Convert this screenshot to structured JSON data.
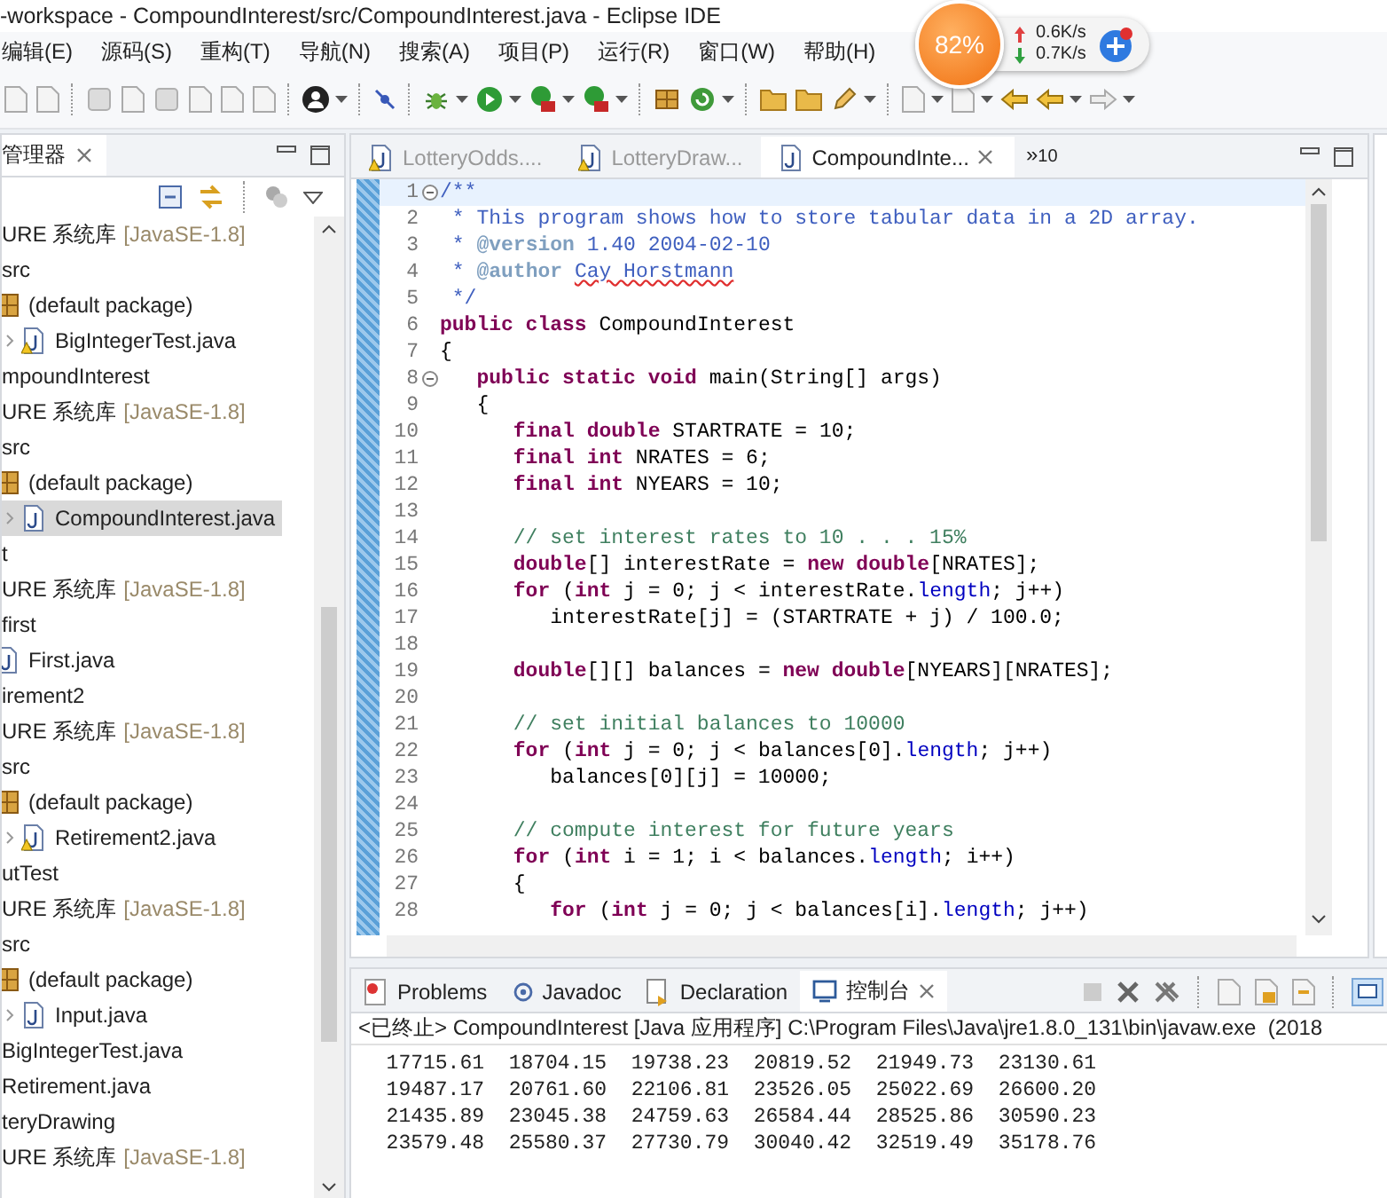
{
  "window": {
    "title": "-workspace - CompoundInterest/src/CompoundInterest.java - Eclipse IDE"
  },
  "menu": [
    "编辑(E)",
    "源码(S)",
    "重构(T)",
    "导航(N)",
    "搜索(A)",
    "项目(P)",
    "运行(R)",
    "窗口(W)",
    "帮助(H)"
  ],
  "network_widget": {
    "percent": "82%",
    "upload": "0.6K/s",
    "download": "0.7K/s"
  },
  "explorer": {
    "title": "管理器",
    "tree": [
      {
        "kind": "library",
        "label": "URE 系统库",
        "version": "[JavaSE-1.8]",
        "selected": false
      },
      {
        "kind": "folder",
        "label": "src",
        "selected": false,
        "children": [
          {
            "kind": "package",
            "label": "(default package)",
            "selected": false,
            "children": [
              {
                "kind": "java",
                "label": "BigIntegerTest.java",
                "warning": true,
                "selected": false
              }
            ]
          }
        ]
      },
      {
        "kind": "project",
        "label": "mpoundInterest",
        "selected": false,
        "children": [
          {
            "kind": "library",
            "label": "URE 系统库",
            "version": "[JavaSE-1.8]",
            "selected": false
          },
          {
            "kind": "folder",
            "label": "src",
            "selected": false,
            "children": [
              {
                "kind": "package",
                "label": "(default package)",
                "selected": false,
                "children": [
                  {
                    "kind": "java",
                    "label": "CompoundInterest.java",
                    "warning": false,
                    "selected": true
                  }
                ]
              }
            ]
          }
        ]
      },
      {
        "kind": "project",
        "label": "t",
        "selected": false,
        "children": [
          {
            "kind": "library",
            "label": "URE 系统库",
            "version": "[JavaSE-1.8]",
            "selected": false
          },
          {
            "kind": "folder",
            "label": "first",
            "selected": false,
            "children": [
              {
                "kind": "java",
                "label": "First.java",
                "warning": false,
                "selected": false
              }
            ]
          }
        ]
      },
      {
        "kind": "project",
        "label": "irement2",
        "selected": false,
        "children": [
          {
            "kind": "library",
            "label": "URE 系统库",
            "version": "[JavaSE-1.8]",
            "selected": false
          },
          {
            "kind": "folder",
            "label": "src",
            "selected": false,
            "children": [
              {
                "kind": "package",
                "label": "(default package)",
                "selected": false,
                "children": [
                  {
                    "kind": "java",
                    "label": "Retirement2.java",
                    "warning": true,
                    "selected": false
                  }
                ]
              }
            ]
          }
        ]
      },
      {
        "kind": "project",
        "label": "utTest",
        "selected": false,
        "children": [
          {
            "kind": "library",
            "label": "URE 系统库",
            "version": "[JavaSE-1.8]",
            "selected": false
          },
          {
            "kind": "folder",
            "label": "src",
            "selected": false,
            "children": [
              {
                "kind": "package",
                "label": "(default package)",
                "selected": false,
                "children": [
                  {
                    "kind": "java",
                    "label": "Input.java",
                    "warning": false,
                    "selected": false
                  }
                ]
              }
            ]
          }
        ]
      },
      {
        "kind": "java",
        "label": "BigIntegerTest.java",
        "selected": false
      },
      {
        "kind": "java",
        "label": "Retirement.java",
        "selected": false
      },
      {
        "kind": "project",
        "label": "teryDrawing",
        "selected": false,
        "children": [
          {
            "kind": "library",
            "label": "URE 系统库",
            "version": "[JavaSE-1.8]",
            "selected": false
          }
        ]
      }
    ]
  },
  "editor": {
    "tabs": [
      {
        "label": "LotteryOdds....",
        "warning": true,
        "selected": false
      },
      {
        "label": "LotteryDraw...",
        "warning": true,
        "selected": false
      },
      {
        "label": "CompoundInte...",
        "warning": false,
        "selected": true
      }
    ],
    "overflow": {
      "arrows": "»",
      "count": "10"
    },
    "lines": [
      {
        "number": "1",
        "foldable": true,
        "current": true,
        "tokens": [
          {
            "kind": "javadoc",
            "text": "/**"
          }
        ]
      },
      {
        "number": "2",
        "foldable": false,
        "current": false,
        "tokens": [
          {
            "kind": "javadoc",
            "text": " * This program shows how to store tabular data in a 2D array."
          }
        ]
      },
      {
        "number": "3",
        "foldable": false,
        "current": false,
        "tokens": [
          {
            "kind": "javadoc",
            "text": " * "
          },
          {
            "kind": "doctag",
            "text": "@version"
          },
          {
            "kind": "javadoc",
            "text": " 1.40 2004-02-10"
          }
        ]
      },
      {
        "number": "4",
        "foldable": false,
        "current": false,
        "tokens": [
          {
            "kind": "javadoc",
            "text": " * "
          },
          {
            "kind": "doctag",
            "text": "@author "
          },
          {
            "kind": "misspelled",
            "text": "Cay Horstmann"
          }
        ]
      },
      {
        "number": "5",
        "foldable": false,
        "current": false,
        "tokens": [
          {
            "kind": "javadoc",
            "text": " */"
          }
        ]
      },
      {
        "number": "6",
        "foldable": false,
        "current": false,
        "tokens": [
          {
            "kind": "keyword",
            "text": "public class"
          },
          {
            "kind": "plain",
            "text": " CompoundInterest"
          }
        ]
      },
      {
        "number": "7",
        "foldable": false,
        "current": false,
        "tokens": [
          {
            "kind": "plain",
            "text": "{"
          }
        ]
      },
      {
        "number": "8",
        "foldable": true,
        "current": false,
        "tokens": [
          {
            "kind": "keyword",
            "text": "   public static void"
          },
          {
            "kind": "plain",
            "text": " main(String[] args)"
          }
        ]
      },
      {
        "number": "9",
        "foldable": false,
        "current": false,
        "tokens": [
          {
            "kind": "plain",
            "text": "   {"
          }
        ]
      },
      {
        "number": "10",
        "foldable": false,
        "current": false,
        "tokens": [
          {
            "kind": "keyword",
            "text": "      final double"
          },
          {
            "kind": "plain",
            "text": " STARTRATE = 10;"
          }
        ]
      },
      {
        "number": "11",
        "foldable": false,
        "current": false,
        "tokens": [
          {
            "kind": "keyword",
            "text": "      final int"
          },
          {
            "kind": "plain",
            "text": " NRATES = 6;"
          }
        ]
      },
      {
        "number": "12",
        "foldable": false,
        "current": false,
        "tokens": [
          {
            "kind": "keyword",
            "text": "      final int"
          },
          {
            "kind": "plain",
            "text": " NYEARS = 10;"
          }
        ]
      },
      {
        "number": "13",
        "foldable": false,
        "current": false
      },
      {
        "number": "14",
        "foldable": false,
        "current": false,
        "tokens": [
          {
            "kind": "comment",
            "text": "      // set interest rates to 10 . . . 15%"
          }
        ]
      },
      {
        "number": "15",
        "foldable": false,
        "current": false,
        "tokens": [
          {
            "kind": "keyword",
            "text": "      double"
          },
          {
            "kind": "plain",
            "text": "[] interestRate = "
          },
          {
            "kind": "keyword",
            "text": "new double"
          },
          {
            "kind": "plain",
            "text": "[NRATES];"
          }
        ]
      },
      {
        "number": "16",
        "foldable": false,
        "current": false,
        "tokens": [
          {
            "kind": "keyword",
            "text": "      for"
          },
          {
            "kind": "plain",
            "text": " ("
          },
          {
            "kind": "keyword",
            "text": "int"
          },
          {
            "kind": "plain",
            "text": " j = 0; j < interestRate."
          },
          {
            "kind": "field",
            "text": "length"
          },
          {
            "kind": "plain",
            "text": "; j++)"
          }
        ]
      },
      {
        "number": "17",
        "foldable": false,
        "current": false,
        "tokens": [
          {
            "kind": "plain",
            "text": "         interestRate[j] = (STARTRATE + j) / 100.0;"
          }
        ]
      },
      {
        "number": "18",
        "foldable": false,
        "current": false
      },
      {
        "number": "19",
        "foldable": false,
        "current": false,
        "tokens": [
          {
            "kind": "keyword",
            "text": "      double"
          },
          {
            "kind": "plain",
            "text": "[][] balances = "
          },
          {
            "kind": "keyword",
            "text": "new double"
          },
          {
            "kind": "plain",
            "text": "[NYEARS][NRATES];"
          }
        ]
      },
      {
        "number": "20",
        "foldable": false,
        "current": false
      },
      {
        "number": "21",
        "foldable": false,
        "current": false,
        "tokens": [
          {
            "kind": "comment",
            "text": "      // set initial balances to 10000"
          }
        ]
      },
      {
        "number": "22",
        "foldable": false,
        "current": false,
        "tokens": [
          {
            "kind": "keyword",
            "text": "      for"
          },
          {
            "kind": "plain",
            "text": " ("
          },
          {
            "kind": "keyword",
            "text": "int"
          },
          {
            "kind": "plain",
            "text": " j = 0; j < balances[0]."
          },
          {
            "kind": "field",
            "text": "length"
          },
          {
            "kind": "plain",
            "text": "; j++)"
          }
        ]
      },
      {
        "number": "23",
        "foldable": false,
        "current": false,
        "tokens": [
          {
            "kind": "plain",
            "text": "         balances[0][j] = 10000;"
          }
        ]
      },
      {
        "number": "24",
        "foldable": false,
        "current": false
      },
      {
        "number": "25",
        "foldable": false,
        "current": false,
        "tokens": [
          {
            "kind": "comment",
            "text": "      // compute interest for future years"
          }
        ]
      },
      {
        "number": "26",
        "foldable": false,
        "current": false,
        "tokens": [
          {
            "kind": "keyword",
            "text": "      for"
          },
          {
            "kind": "plain",
            "text": " ("
          },
          {
            "kind": "keyword",
            "text": "int"
          },
          {
            "kind": "plain",
            "text": " i = 1; i < balances."
          },
          {
            "kind": "field",
            "text": "length"
          },
          {
            "kind": "plain",
            "text": "; i++)"
          }
        ]
      },
      {
        "number": "27",
        "foldable": false,
        "current": false,
        "tokens": [
          {
            "kind": "plain",
            "text": "      {"
          }
        ]
      },
      {
        "number": "28",
        "foldable": false,
        "current": false,
        "tokens": [
          {
            "kind": "keyword",
            "text": "         for"
          },
          {
            "kind": "plain",
            "text": " ("
          },
          {
            "kind": "keyword",
            "text": "int"
          },
          {
            "kind": "plain",
            "text": " j = 0; j < balances[i]."
          },
          {
            "kind": "field",
            "text": "length"
          },
          {
            "kind": "plain",
            "text": "; j++)"
          }
        ]
      }
    ]
  },
  "bottom_panel": {
    "tabs": [
      {
        "kind": "problems",
        "label": "Problems",
        "selected": false
      },
      {
        "kind": "javadoc",
        "label": "Javadoc",
        "selected": false
      },
      {
        "kind": "declaration",
        "label": "Declaration",
        "selected": false
      },
      {
        "kind": "console",
        "label": "控制台",
        "selected": true
      }
    ],
    "console_header": "<已终止> CompoundInterest [Java 应用程序] C:\\Program Files\\Java\\jre1.8.0_131\\bin\\javaw.exe  (2018",
    "output": [
      "  17715.61  18704.15  19738.23  20819.52  21949.73  23130.61",
      "  19487.17  20761.60  22106.81  23526.05  25022.69  26600.20",
      "  21435.89  23045.38  24759.63  26584.44  28525.86  30590.23",
      "  23579.48  25580.37  27730.79  30040.42  32519.49  35178.76"
    ]
  }
}
